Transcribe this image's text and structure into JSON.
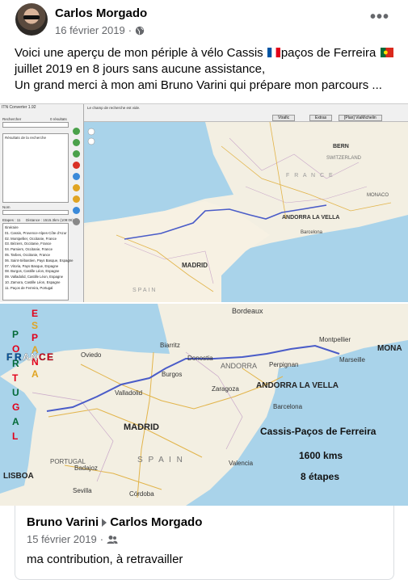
{
  "post": {
    "author": "Carlos Morgado",
    "date": "16 février 2019",
    "separator": "·",
    "privacy_icon": "globe-icon",
    "more_icon": "more-options-icon",
    "more_label": "•••",
    "text_line1_a": "Voici  une aperçu de mon périple  à vélo Cassis ",
    "text_line1_b": "paços de Ferreira ",
    "text_line2": "juillet 2019 en 8 jours sans aucune assistance,",
    "text_line3": "Un grand merci à mon ami Bruno Varini qui prépare mon parcours ..."
  },
  "screenshot1": {
    "app_title": "ITN Converter 1.92",
    "search_label": "Rechercher",
    "results_count": "0 résultats",
    "results_title": "Résultats de la recherche",
    "name_label": "Nom",
    "stages_label": "Etapes : 11",
    "distance_label": "Distance : 1515.3km (109:06)",
    "itinerary_title": "Itinéraire",
    "route": [
      "01. Cassis, Provence-Alpes-Côte d'Azur",
      "02. Montpellier, Occitanie, France",
      "03. Béziers, Occitanie, France",
      "04. Pamiers, Occitanie, France",
      "05. Tarbes, Occitanie, France",
      "06. Saint-Sébastien, Pays Basque, Espagne",
      "07. Vitoria, Pays Basque, Espagne",
      "08. Burgos, Castille Léon, Espagne",
      "09. Valladolid, Castille Léon, Espagne",
      "10. Zamora, Castille Léon, Espagne",
      "11. Paços de Ferreira, Portugal"
    ],
    "search_hint": "Le champ de recherche est vide.",
    "btn_vtrafic": "Vtrafic",
    "btn_extras": "Extras",
    "btn_plan": "[Plan] ViaMichelin",
    "map_labels": {
      "bern": "BERN",
      "switzerland": "SWITZERLAND",
      "monaco": "MONACO",
      "andorra": "ANDORRA LA VELLA",
      "madrid": "MADRID",
      "barcelona": "Barcelona",
      "france": "F R A N C E",
      "spain": "SPAIN"
    }
  },
  "screenshot2": {
    "map_labels": {
      "bordeaux": "Bordeaux",
      "monaco": "MONA",
      "andorra_small": "ANDORRA",
      "andorra": "ANDORRA LA VELLA",
      "madrid": "MADRID",
      "lisboa": "LISBOA",
      "portugal": "PORTUGAL",
      "spain": "S P A I N",
      "oviedo": "Oviedo",
      "valladolid": "Valladolid",
      "zaragoza": "Zaragoza",
      "barcelona": "Barcelona",
      "valencia": "Valencia",
      "sevilla": "Sevilla",
      "montpellier": "Montpellier",
      "marseille": "Marseille",
      "perpignan": "Perpignan",
      "donostia": "Donostia",
      "biarritz": "Biarritz",
      "burgos": "Burgos",
      "cordoba": "Córdoba",
      "badajoz": "Badajoz"
    },
    "portugal_letters": [
      "P",
      "O",
      "R",
      "T",
      "U",
      "G",
      "A",
      "L"
    ],
    "espana_letters": [
      "E",
      "S",
      "P",
      "A",
      "N",
      "A"
    ],
    "france_word": "FRANCE",
    "overlay_title": "Cassis-Paços de Ferreira",
    "overlay_distance": "1600 kms",
    "overlay_stages": "8 étapes"
  },
  "reply": {
    "from": "Bruno Varini",
    "to": "Carlos Morgado",
    "date": "15 février 2019",
    "separator": "·",
    "audience_icon": "friends-icon",
    "text": "ma contribution, à retravailler"
  },
  "colors": {
    "route": "#4a5cc8",
    "sea": "#a9d3ea",
    "land": "#f3efe2",
    "france_red": "#e2001a",
    "france_blue": "#0055a4",
    "portugal_green": "#046a38"
  }
}
